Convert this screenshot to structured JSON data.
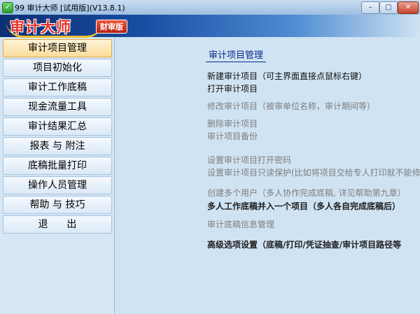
{
  "window": {
    "title": "99  审计大师 [试用版](V13.8.1)",
    "app_icon_glyph": "✓",
    "minimize_glyph": "–",
    "maximize_glyph": "□",
    "close_glyph": "✕"
  },
  "banner": {
    "logo_text": "审计大师",
    "edition_badge": "财审版"
  },
  "sidebar": {
    "items": [
      {
        "label": "审计项目管理",
        "active": true
      },
      {
        "label": "项目初始化"
      },
      {
        "label": "审计工作底稿"
      },
      {
        "label": "现金流量工具"
      },
      {
        "label": "审计结果汇总"
      },
      {
        "label": "报表 与 附注"
      },
      {
        "label": "底稿批量打印"
      },
      {
        "label": "操作人员管理"
      },
      {
        "label": "帮助 与 技巧"
      },
      {
        "label": "退      出"
      }
    ]
  },
  "content": {
    "title": "审计项目管理",
    "actions": [
      {
        "label": "新建审计项目（可主界面直接点鼠标右键）",
        "style": "dark"
      },
      {
        "label": "打开审计项目",
        "style": "dark"
      },
      {
        "label": "修改审计项目（被审单位名称，审计期间等）",
        "style": "gray"
      },
      {
        "label": "删除审计项目",
        "style": "gray"
      },
      {
        "label": "审计项目备份",
        "style": "gray"
      },
      {
        "label": "设置审计项目打开密码",
        "style": "gray"
      },
      {
        "label": "设置审计项目只读保护(比如将项目交给专人打印就不能修",
        "style": "gray"
      },
      {
        "label": "创建多个用户（多人协作完成底稿, 详见帮助第九章）",
        "style": "gray"
      },
      {
        "label": "多人工作底稿并入一个项目（多人各自完成底稿后）",
        "style": "bold"
      },
      {
        "label": "审计底稿信息管理",
        "style": "gray"
      },
      {
        "label": "高级选项设置（底稿/打印/凭证抽查/审计项目路径等",
        "style": "bold"
      }
    ]
  },
  "colors": {
    "title_link": "#0b2a8f",
    "active_item_bg": "#fbdc9a",
    "banner_dark": "#0b2f73",
    "logo_red": "#e8342c"
  }
}
